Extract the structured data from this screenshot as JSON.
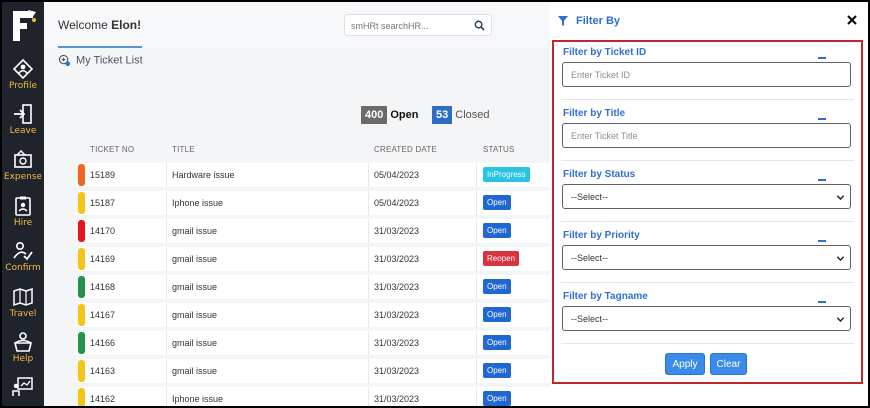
{
  "sidebar": {
    "items": [
      {
        "label": "Profile",
        "icon": "profile-icon"
      },
      {
        "label": "Leave",
        "icon": "leave-icon"
      },
      {
        "label": "Expense",
        "icon": "expense-icon"
      },
      {
        "label": "Hire",
        "icon": "hire-icon"
      },
      {
        "label": "Confirm",
        "icon": "confirm-icon"
      },
      {
        "label": "Travel",
        "icon": "travel-icon"
      },
      {
        "label": "Help",
        "icon": "help-icon"
      }
    ]
  },
  "header": {
    "welcome_prefix": "Welcome ",
    "user_name": "Elon!",
    "search_placeholder": "smHRt searchHR..."
  },
  "tab": {
    "label": "My Ticket List"
  },
  "counts": {
    "open_value": "400",
    "open_label": "Open",
    "closed_value": "53",
    "closed_label": "Closed"
  },
  "table": {
    "headers": [
      "TICKET NO",
      "TITLE",
      "CREATED DATE",
      "STATUS"
    ],
    "rows": [
      {
        "ticket": "15189",
        "title": "Hardware issue",
        "date": "05/04/2023",
        "status": "InProgress",
        "bar": "#f26522",
        "status_color": "#29c3e6"
      },
      {
        "ticket": "15187",
        "title": "Iphone issue",
        "date": "05/04/2023",
        "status": "Open",
        "bar": "#f5c518",
        "status_color": "#1f67d2"
      },
      {
        "ticket": "14170",
        "title": "gmail issue",
        "date": "31/03/2023",
        "status": "Open",
        "bar": "#e8141c",
        "status_color": "#1f67d2"
      },
      {
        "ticket": "14169",
        "title": "gmail issue",
        "date": "31/03/2023",
        "status": "Reopen",
        "bar": "#f5c518",
        "status_color": "#d9333f"
      },
      {
        "ticket": "14168",
        "title": "gmail issue",
        "date": "31/03/2023",
        "status": "Open",
        "bar": "#23924a",
        "status_color": "#1f67d2"
      },
      {
        "ticket": "14167",
        "title": "gmail issue",
        "date": "31/03/2023",
        "status": "Open",
        "bar": "#f5c518",
        "status_color": "#1f67d2"
      },
      {
        "ticket": "14166",
        "title": "gmail issue",
        "date": "31/03/2023",
        "status": "Open",
        "bar": "#23924a",
        "status_color": "#1f67d2"
      },
      {
        "ticket": "14163",
        "title": "gmail issue",
        "date": "31/03/2023",
        "status": "Open",
        "bar": "#f5c518",
        "status_color": "#1f67d2"
      },
      {
        "ticket": "14162",
        "title": "Iphone issue",
        "date": "31/03/2023",
        "status": "Open",
        "bar": "#f5c518",
        "status_color": "#1f67d2"
      }
    ]
  },
  "filter": {
    "title": "Filter By",
    "ticket_id_label": "Filter by Ticket ID",
    "ticket_id_placeholder": "Enter Ticket ID",
    "title_label": "Filter by Title",
    "title_placeholder": "Enter Ticket Title",
    "status_label": "Filter by Status",
    "status_selected": "--Select--",
    "priority_label": "Filter by Priority",
    "priority_selected": "--Select--",
    "tagname_label": "Filter by Tagname",
    "tagname_selected": "--Select--",
    "apply_label": "Apply",
    "clear_label": "Clear"
  },
  "colors": {
    "accent": "#2f6fd1",
    "sidebar_bg": "#1f232b",
    "sidebar_label": "#f5b942",
    "open_count_bg": "#6b6b6b",
    "closed_count_bg": "#2d6dc4",
    "panel_border": "#c0262e"
  }
}
